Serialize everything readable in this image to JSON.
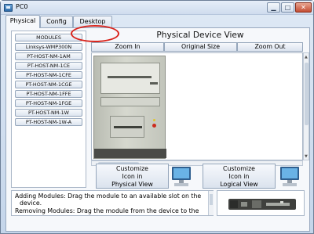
{
  "window": {
    "title": "PC0"
  },
  "title_buttons": {
    "minimize": "▁",
    "maximize": "□",
    "close": "✕"
  },
  "tabs": [
    {
      "label": "Physical",
      "active": true
    },
    {
      "label": "Config",
      "active": false
    },
    {
      "label": "Desktop",
      "active": false,
      "highlighted": true
    }
  ],
  "modules": {
    "header": "MODULES",
    "items": [
      "Linksys-WMP300N",
      "PT-HOST-NM-1AM",
      "PT-HOST-NM-1CE",
      "PT-HOST-NM-1CFE",
      "PT-HOST-NM-1CGE",
      "PT-HOST-NM-1FFE",
      "PT-HOST-NM-1FGE",
      "PT-HOST-NM-1W",
      "PT-HOST-NM-1W-A"
    ]
  },
  "device_view": {
    "title": "Physical Device View",
    "zoom_in": "Zoom In",
    "original_size": "Original Size",
    "zoom_out": "Zoom Out"
  },
  "customize": {
    "physical": [
      "Customize",
      "Icon in",
      "Physical View"
    ],
    "logical": [
      "Customize",
      "Icon in",
      "Logical View"
    ]
  },
  "info_text": [
    "Adding Modules: Drag the module to an available slot on the",
    "device.",
    "Removing Modules: Drag the module from the device to the"
  ],
  "colors": {
    "highlight_ring": "#d9241c",
    "power_light": "#cc2b1d"
  },
  "icons": [
    "app-icon",
    "monitor-icon",
    "module-preview-icon"
  ]
}
